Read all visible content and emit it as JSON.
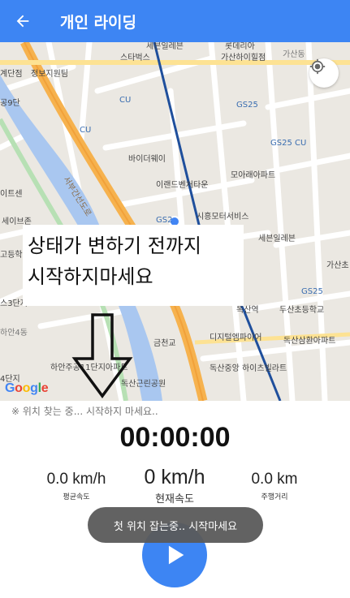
{
  "app_bar": {
    "title": "개인 라이딩",
    "back_icon": "arrow-left-icon",
    "color": "#3d85f3"
  },
  "map": {
    "attribution": "Google",
    "locate_icon": "my-location-icon",
    "labels": [
      "세븐일레븐",
      "롯데리아",
      "가산하이힐점",
      "가산동",
      "스타벅스",
      "계단점",
      "정보지원팀",
      "CU",
      "GS25",
      "공9단",
      "CU",
      "바이더웨이",
      "이랜드벤처타운",
      "모아래아파트",
      "서부간선도로",
      "이트센",
      "GS25 CU",
      "시흥모터서비스",
      "세이브존",
      "세븐일레븐",
      "고등학교",
      "가산초",
      "GS25",
      "독산역",
      "두산초등학교",
      "하안4동",
      "금천교",
      "디지털엠파이어",
      "독산삼환아파트",
      "하안주공11단지아파트",
      "독산중앙 하이츠빌라트",
      "독산근린공원",
      "4단지",
      "스3단지",
      "GS2"
    ]
  },
  "overlay_note": {
    "line1": "상태가 변하기 전까지",
    "line2": "시작하지마세요"
  },
  "status_text": "※ 위치 찾는 중... 시작하지 마세요..",
  "timer": "00:00:00",
  "stats": {
    "avg_speed": {
      "value": "0.0 km/h",
      "label": "평균속도"
    },
    "current_speed": {
      "value": "0 km/h",
      "label": "현재속도"
    },
    "distance": {
      "value": "0.0 km",
      "label": "주행거리"
    }
  },
  "toast": "첫 위치 잡는중.. 시작마세요",
  "play_button": {
    "icon": "play-icon"
  }
}
